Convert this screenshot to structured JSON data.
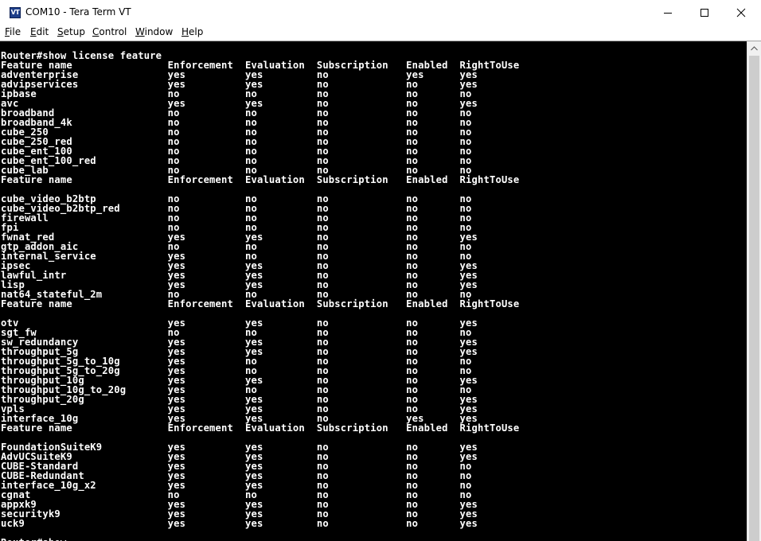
{
  "window": {
    "title": "COM10 - Tera Term VT",
    "icon_label": "VT",
    "icon": "teraterm-app-icon"
  },
  "controls": {
    "minimize_icon": "minimize-icon",
    "maximize_icon": "maximize-icon",
    "close_icon": "close-icon"
  },
  "menu": [
    {
      "label": "File",
      "accel": "F",
      "rest": "ile"
    },
    {
      "label": "Edit",
      "accel": "E",
      "rest": "dit"
    },
    {
      "label": "Setup",
      "accel": "S",
      "rest": "etup"
    },
    {
      "label": "Control",
      "accel": "C",
      "rest": "ontrol"
    },
    {
      "label": "Window",
      "accel": "W",
      "rest": "indow"
    },
    {
      "label": "Help",
      "accel": "H",
      "rest": "elp"
    }
  ],
  "terminal": {
    "lines": [
      "Router#show license feature",
      "Feature name                Enforcement  Evaluation  Subscription   Enabled  RightToUse",
      "adventerprise               yes          yes         no             yes      yes",
      "advipservices               yes          yes         no             no       yes",
      "ipbase                      no           no          no             no       no",
      "avc                         yes          yes         no             no       yes",
      "broadband                   no           no          no             no       no",
      "broadband_4k                no           no          no             no       no",
      "cube_250                    no           no          no             no       no",
      "cube_250_red                no           no          no             no       no",
      "cube_ent_100                no           no          no             no       no",
      "cube_ent_100_red            no           no          no             no       no",
      "cube_lab                    no           no          no             no       no",
      "Feature name                Enforcement  Evaluation  Subscription   Enabled  RightToUse",
      "",
      "cube_video_b2btp            no           no          no             no       no",
      "cube_video_b2btp_red        no           no          no             no       no",
      "firewall                    no           no          no             no       no",
      "fpi                         no           no          no             no       no",
      "fwnat_red                   yes          yes         no             no       yes",
      "gtp_addon_aic               no           no          no             no       no",
      "internal_service            yes          no          no             no       no",
      "ipsec                       yes          yes         no             no       yes",
      "lawful_intr                 yes          yes         no             no       yes",
      "lisp                        yes          yes         no             no       yes",
      "nat64_stateful_2m           no           no          no             no       no",
      "Feature name                Enforcement  Evaluation  Subscription   Enabled  RightToUse",
      "",
      "otv                         yes          yes         no             no       yes",
      "sgt_fw                      no           no          no             no       no",
      "sw_redundancy               yes          yes         no             no       yes",
      "throughput_5g               yes          yes         no             no       yes",
      "throughput_5g_to_10g        yes          no          no             no       no",
      "throughput_5g_to_20g        yes          no          no             no       no",
      "throughput_10g              yes          yes         no             no       yes",
      "throughput_10g_to_20g       yes          no          no             no       no",
      "throughput_20g              yes          yes         no             no       yes",
      "vpls                        yes          yes         no             no       yes",
      "interface_10g               yes          yes         no             yes      yes",
      "Feature name                Enforcement  Evaluation  Subscription   Enabled  RightToUse",
      "",
      "FoundationSuiteK9           yes          yes         no             no       yes",
      "AdvUCSuiteK9                yes          yes         no             no       yes",
      "CUBE-Standard               yes          yes         no             no       no",
      "CUBE-Redundant              yes          yes         no             no       no",
      "interface_10g_x2            yes          yes         no             no       no",
      "cgnat                       no           no          no             no       no",
      "appxk9                      yes          yes         no             no       yes",
      "securityk9                  yes          yes         no             no       yes",
      "uck9                        yes          yes         no             no       yes",
      "",
      "Router#show"
    ]
  },
  "scrollbar": {
    "up_icon": "scroll-up-arrow-icon"
  }
}
